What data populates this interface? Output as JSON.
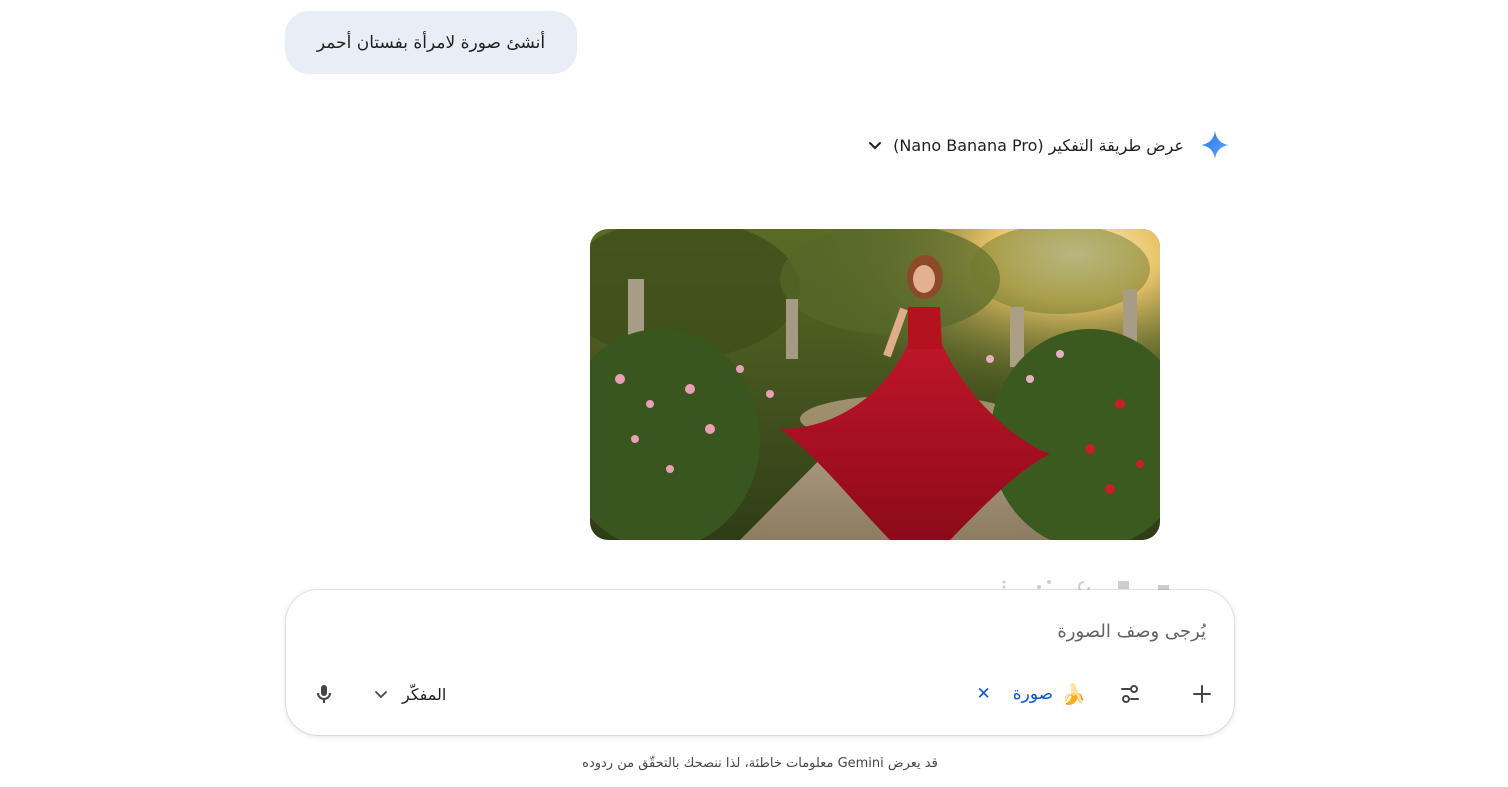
{
  "user_message": "أنشئ صورة لامرأة بفستان أحمر",
  "response": {
    "thinking_toggle_label": "عرض طريقة التفكير (Nano Banana Pro)",
    "image_subject": "woman-in-red-dress-garden"
  },
  "composer": {
    "placeholder": "يُرجى وصف الصورة",
    "chip_label": "صورة",
    "chip_icon": "banana-emoji",
    "model_label": "المفكّر"
  },
  "footer": {
    "disclaimer": "قد يعرض Gemini معلومات خاطئة، لذا ننصحك بالتحقّق من ردوده"
  },
  "colors": {
    "accent_blue": "#0b57d0",
    "bubble_bg": "#e9eef6",
    "spark_blue": "#4285f4"
  }
}
